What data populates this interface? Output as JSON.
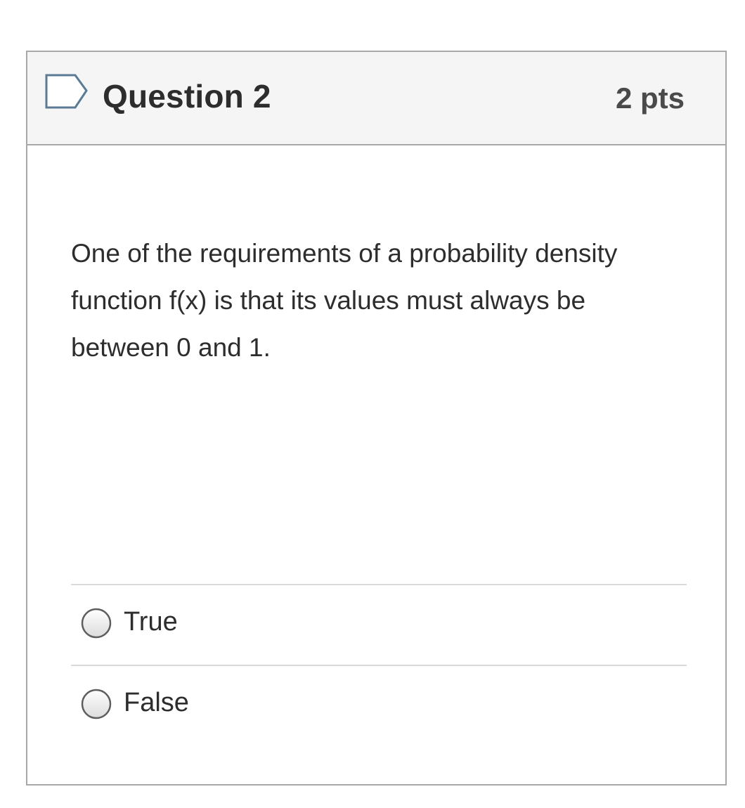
{
  "question": {
    "title": "Question 2",
    "points": "2 pts",
    "flag_icon": "bookmark-flag-icon",
    "text": "One of the requirements of a probability density function f(x) is that its values must always be between 0 and 1.",
    "answers": [
      {
        "label": "True",
        "selected": false
      },
      {
        "label": "False",
        "selected": false
      }
    ]
  },
  "colors": {
    "header_bg": "#f5f5f5",
    "card_border": "#a8a8a8",
    "divider": "#d9d9d9",
    "flag_stroke": "#5a7a95",
    "text": "#2d2d2d"
  }
}
